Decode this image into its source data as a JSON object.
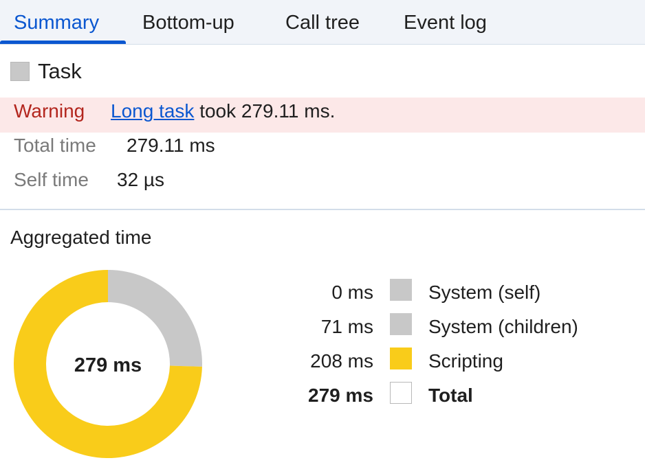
{
  "tabs": [
    {
      "label": "Summary",
      "active": true
    },
    {
      "label": "Bottom-up",
      "active": false
    },
    {
      "label": "Call tree",
      "active": false
    },
    {
      "label": "Event log",
      "active": false
    }
  ],
  "event": {
    "swatch_color": "#c8c8c8",
    "title": "Task"
  },
  "warning": {
    "label": "Warning",
    "link_text": "Long task",
    "message": "took 279.11 ms."
  },
  "details": {
    "total_time_label": "Total time",
    "total_time_value": "279.11 ms",
    "self_time_label": "Self time",
    "self_time_value": "32 µs"
  },
  "aggregated": {
    "heading": "Aggregated time",
    "center_label": "279 ms",
    "legend": [
      {
        "value": "0 ms",
        "label": "System (self)",
        "color": "#c8c8c8"
      },
      {
        "value": "71 ms",
        "label": "System (children)",
        "color": "#c8c8c8"
      },
      {
        "value": "208 ms",
        "label": "Scripting",
        "color": "#f9cc1a"
      },
      {
        "value": "279 ms",
        "label": "Total",
        "color": "#ffffff"
      }
    ]
  },
  "chart_data": {
    "type": "pie",
    "categories": [
      "System (self)",
      "System (children)",
      "Scripting"
    ],
    "values": [
      0,
      71,
      208
    ],
    "colors": [
      "#c8c8c8",
      "#c8c8c8",
      "#f9cc1a"
    ],
    "title": "Aggregated time",
    "total_label": "279 ms"
  }
}
